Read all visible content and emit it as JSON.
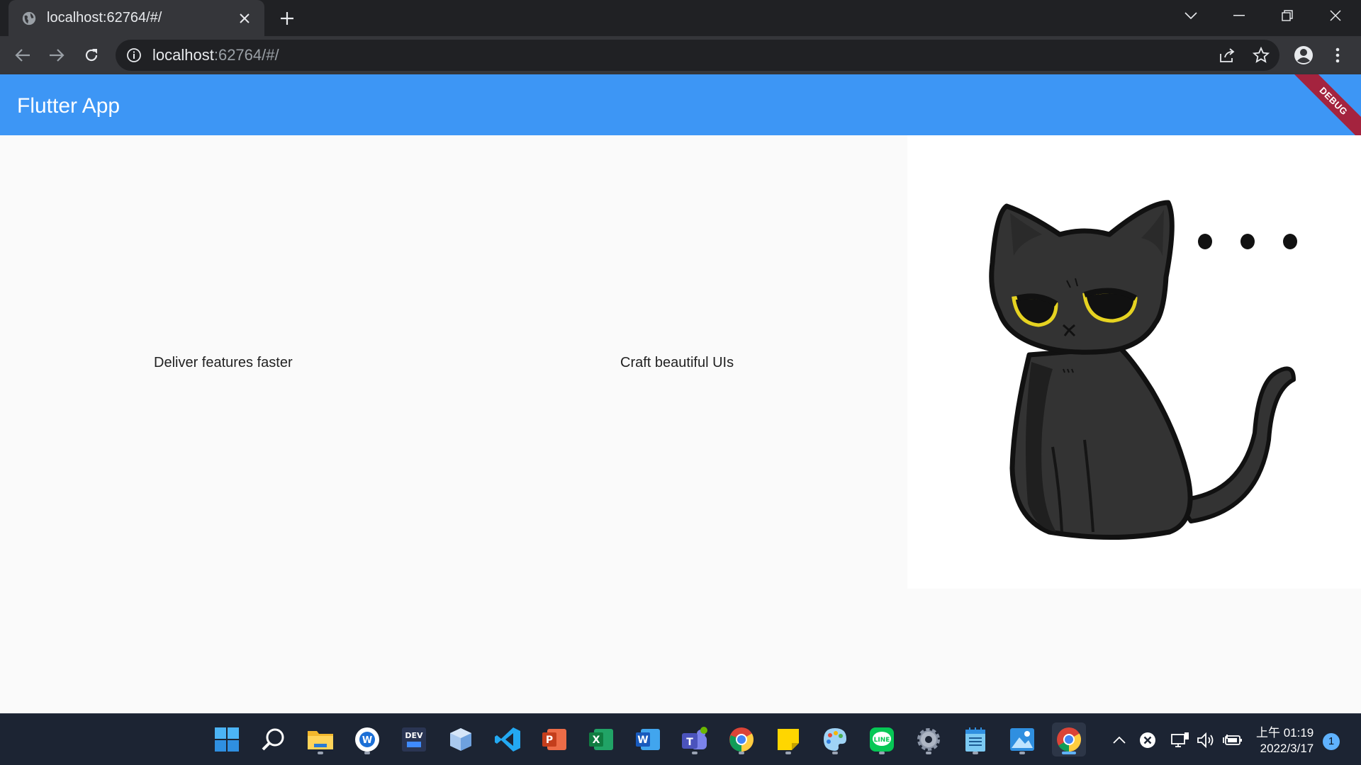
{
  "browser": {
    "tab_title": "localhost:62764/#/",
    "url_host": "localhost",
    "url_rest": ":62764/#/"
  },
  "app": {
    "title": "Flutter App",
    "debug_banner": "DEBUG",
    "features": [
      "Deliver features faster",
      "Craft beautiful UIs"
    ],
    "primary_color": "#3d96f5"
  },
  "taskbar": {
    "apps": [
      "windows-start",
      "search",
      "file-explorer",
      "word-app",
      "dev-tools",
      "box-app",
      "vscode",
      "powerpoint",
      "excel",
      "word",
      "teams",
      "chrome",
      "sticky-notes",
      "paint",
      "line",
      "settings",
      "notepad",
      "photos",
      "chrome-active"
    ],
    "clock_time": "上午 01:19",
    "clock_date": "2022/3/17",
    "notification_count": "1"
  }
}
